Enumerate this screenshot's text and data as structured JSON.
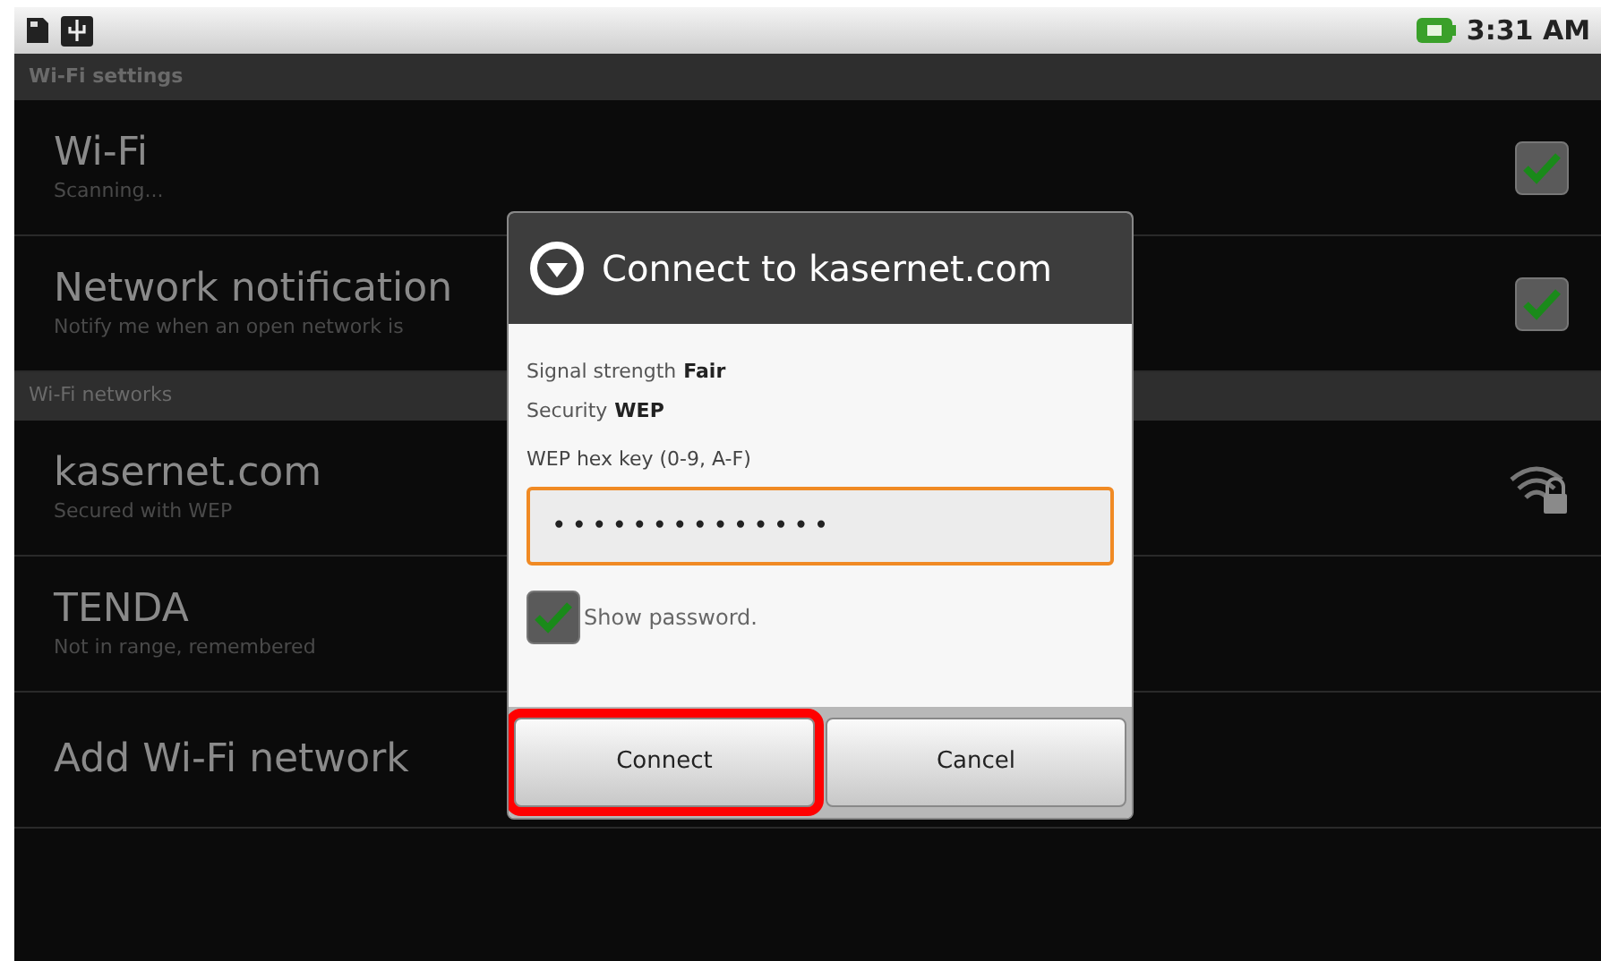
{
  "status_bar": {
    "time": "3:31 AM"
  },
  "header": "Wi-Fi settings",
  "settings": [
    {
      "title": "Wi-Fi",
      "summary": "Scanning...",
      "checked": true
    },
    {
      "title": "Network notification",
      "summary": "Notify me when an open network is",
      "checked": true
    }
  ],
  "networks_header": "Wi-Fi networks",
  "networks": [
    {
      "kind": "network",
      "name": "kasernet.com",
      "summary": "Secured with WEP",
      "secured": true
    },
    {
      "kind": "network",
      "name": "TENDA",
      "summary": "Not in range, remembered",
      "secured": false
    },
    {
      "kind": "action",
      "name": "Add Wi-Fi network"
    }
  ],
  "dialog": {
    "title": "Connect to kasernet.com",
    "info": [
      {
        "label": "Signal strength",
        "value": "Fair"
      },
      {
        "label": "Security",
        "value": "WEP"
      }
    ],
    "key_label": "WEP hex key (0-9, A-F)",
    "key_value": "••••••••••••••",
    "show_password": {
      "label": "Show password.",
      "checked": true
    },
    "buttons": [
      {
        "label": "Connect",
        "highlighted": true
      },
      {
        "label": "Cancel",
        "highlighted": false
      }
    ]
  }
}
